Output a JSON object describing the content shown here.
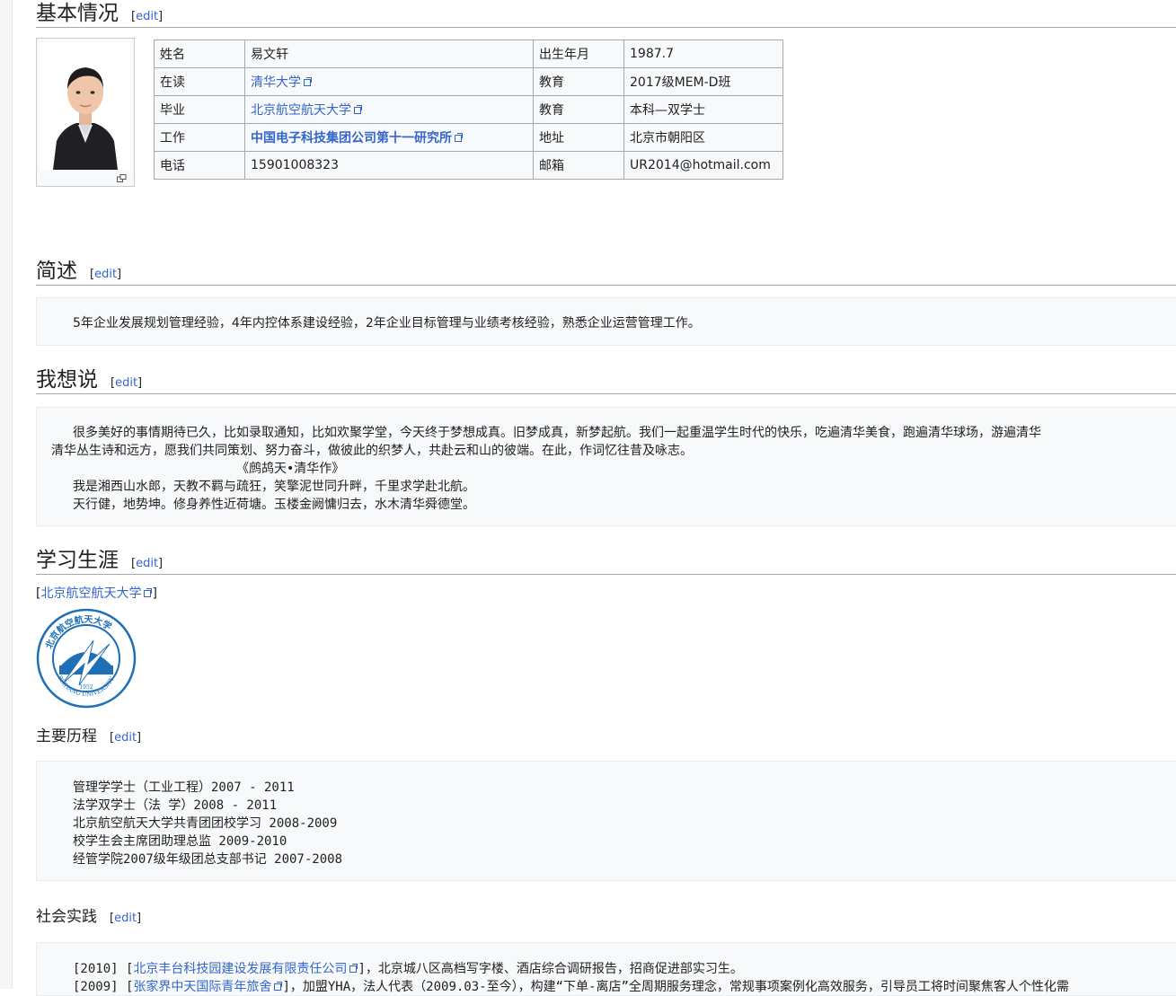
{
  "edit_label": "edit",
  "sections": {
    "basic": "基本情况",
    "summary": "简述",
    "thoughts": "我想说",
    "study": "学习生涯",
    "history": "主要历程",
    "social": "社会实践"
  },
  "info_table": {
    "rows": [
      {
        "k1": "姓名",
        "v1": "易文轩",
        "k2": "出生年月",
        "v2": "1987.7"
      },
      {
        "k1": "在读",
        "v1": "清华大学",
        "k2": "教育",
        "v2": "2017级MEM-D班"
      },
      {
        "k1": "毕业",
        "v1": "北京航空航天大学",
        "k2": "教育",
        "v2": "本科—双学士"
      },
      {
        "k1": "工作",
        "v1": "中国电子科技集团公司第十一研究所",
        "k2": "地址",
        "v2": "北京市朝阳区"
      },
      {
        "k1": "电话",
        "v1": "15901008323",
        "k2": "邮箱",
        "v2": "UR2014@hotmail.com"
      }
    ]
  },
  "summary_text": "5年企业发展规划管理经验，4年内控体系建设经验，2年企业目标管理与业绩考核经验，熟悉企业运营管理工作。",
  "thoughts": {
    "line1": "很多美好的事情期待已久，比如录取通知，比如欢聚学堂，今天终于梦想成真。旧梦成真，新梦起航。我们一起重温学生时代的快乐，吃遍清华美食，跑遍清华球场，游遍清华",
    "line2": "清华丛生诗和远方，愿我们共同策划、努力奋斗，做彼此的织梦人，共赴云和山的彼端。在此，作词忆往昔及咏志。",
    "poem_title": "《鹧鸪天•清华作》",
    "poem1": "我是湘西山水郎，天教不羁与疏狂，笑擎泥世同升畔，千里求学赴北航。",
    "poem2": "天行健，地势坤。修身养性近荷塘。玉楼金阙慵归去，水木清华舜德堂。"
  },
  "study": {
    "open_bracket": "[",
    "school_link": "北京航空航天大学",
    "close_bracket": "]",
    "logo_year": "1952",
    "logo_bottom_text": "BEIHANG UNIVERSITY",
    "logo_top_text": "北京航空航天大学"
  },
  "history_lines": [
    "管理学学士（工业工程）2007 - 2011",
    "法学双学士（法    学）2008 - 2011",
    "北京航空航天大学共青团团校学习  2008-2009",
    "校学生会主席团助理总监  2009-2010",
    "经管学院2007级年级团总支部书记  2007-2008"
  ],
  "social": {
    "l1_year": "[2010] [",
    "l1_link": "北京丰台科技园建设发展有限责任公司",
    "l1_rest": "]，北京城八区高档写字楼、酒店综合调研报告，招商促进部实习生。",
    "l2_year": "[2009] [",
    "l2_link": "张家界中天国际青年旅舍",
    "l2_rest": "]，加盟YHA，法人代表（2009.03-至今），构建“下单-离店”全周期服务理念，常规事项案例化高效服务，引导员工将时间聚焦客人个性化需"
  }
}
